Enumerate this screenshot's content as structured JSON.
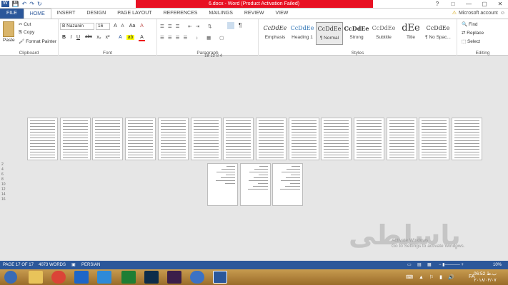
{
  "window": {
    "title": "6.docx - Word (Product Activation Failed)",
    "controls": [
      "?",
      "□",
      "—",
      "▢",
      "✕"
    ]
  },
  "qat": [
    "W",
    "💾",
    "↶",
    "↷",
    "↻"
  ],
  "tabs": [
    "FILE",
    "HOME",
    "INSERT",
    "DESIGN",
    "PAGE LAYOUT",
    "REFERENCES",
    "MAILINGS",
    "REVIEW",
    "VIEW"
  ],
  "active_tab": "HOME",
  "account": {
    "warning_icon": "⚠",
    "label": "Microsoft account",
    "smiley": "☺"
  },
  "clipboard": {
    "paste": "Paste",
    "cut": "Cut",
    "copy": "Copy",
    "format_painter": "Format Painter",
    "label": "Clipboard"
  },
  "font": {
    "name": "B Nazanin",
    "size": "16",
    "grow": "A",
    "shrink": "A",
    "case": "Aa",
    "clear": "A",
    "bold": "B",
    "italic": "I",
    "underline": "U",
    "strike": "abc",
    "sub": "x₂",
    "sup": "x²",
    "effects": "A",
    "highlight": "ab",
    "color": "A",
    "label": "Font"
  },
  "paragraph": {
    "label": "Paragraph",
    "marks": "¶"
  },
  "styles": {
    "label": "Styles",
    "items": [
      {
        "preview": "CcDdEe",
        "name": "Emphasis"
      },
      {
        "preview": "CcDdEe",
        "name": "Heading 1"
      },
      {
        "preview": "CcDdEe",
        "name": "¶ Normal"
      },
      {
        "preview": "CcDdEe",
        "name": "Strong"
      },
      {
        "preview": "CcDdEe",
        "name": "Subtitle"
      },
      {
        "preview": "dEe",
        "name": "Title"
      },
      {
        "preview": "CcDdEe",
        "name": "¶ No Spac..."
      }
    ]
  },
  "editing": {
    "find": "Find",
    "replace": "Replace",
    "select": "Select",
    "label": "Editing"
  },
  "ruler": {
    "marks": "18  12  8  4"
  },
  "vruler": [
    "2",
    "4",
    "6",
    "8",
    "10",
    "12",
    "14",
    "16"
  ],
  "pages": {
    "row1_count": 14,
    "row2_count": 3
  },
  "watermark": {
    "logo": "باسلطی",
    "line1": "Activate Windows",
    "line2": "Go to Settings to activate Windows."
  },
  "status": {
    "page": "PAGE 17 OF 17",
    "words": "4073 WORDS",
    "language": "PERSIAN",
    "zoom": "10%"
  },
  "taskbar": {
    "time": "06:52 ب.ظ",
    "date": "۲۰۱۸/۰۴/۰۷",
    "lang": "FA"
  }
}
